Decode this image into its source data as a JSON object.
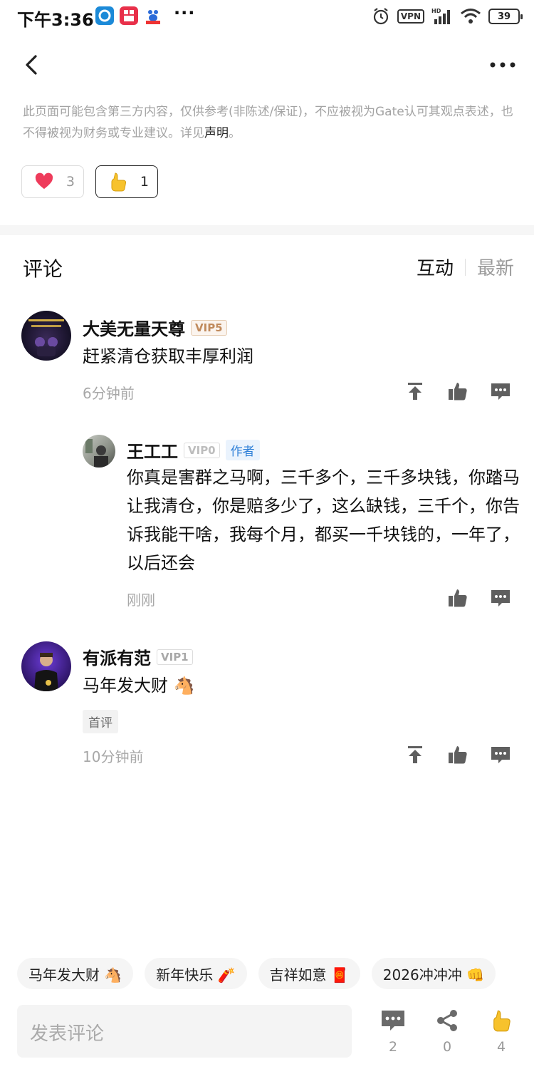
{
  "status_bar": {
    "time": "下午3:36",
    "vpn": "VPN",
    "battery": "39"
  },
  "disclaimer": {
    "text": "此页面可能包含第三方内容，仅供参考(非陈述/保证)，不应被视为Gate认可其观点表述，也不得被视为财务或专业建议。详见",
    "link": "声明",
    "suffix": "。"
  },
  "reactions": [
    {
      "icon": "heart-icon",
      "count": "3"
    },
    {
      "icon": "thumbs-up-emoji-icon",
      "count": "1"
    }
  ],
  "comments_header": {
    "title": "评论",
    "tabs": [
      "互动",
      "最新"
    ]
  },
  "comments": [
    {
      "user": "大美无量天尊",
      "vip": "VIP5",
      "text": "赶紧清仓获取丰厚利润",
      "time": "6分钟前"
    },
    {
      "user": "王工工",
      "vip": "VIP0",
      "author_tag": "作者",
      "text": "你真是害群之马啊，三千多个，三千多块钱，你踏马让我清仓，你是赔多少了，这么缺钱，三千个，你告诉我能干啥，我每个月，都买一千块钱的，一年了，以后还会",
      "time": "刚刚"
    },
    {
      "user": "有派有范",
      "vip": "VIP1",
      "text": "马年发大财 🐴",
      "tag": "首评",
      "time": "10分钟前"
    }
  ],
  "quick_replies": [
    "马年发大财 🐴",
    "新年快乐 🧨",
    "吉祥如意 🧧",
    "2026冲冲冲 👊"
  ],
  "bottom_bar": {
    "input_placeholder": "发表评论",
    "comment_count": "2",
    "share_count": "0",
    "like_count": "4"
  }
}
